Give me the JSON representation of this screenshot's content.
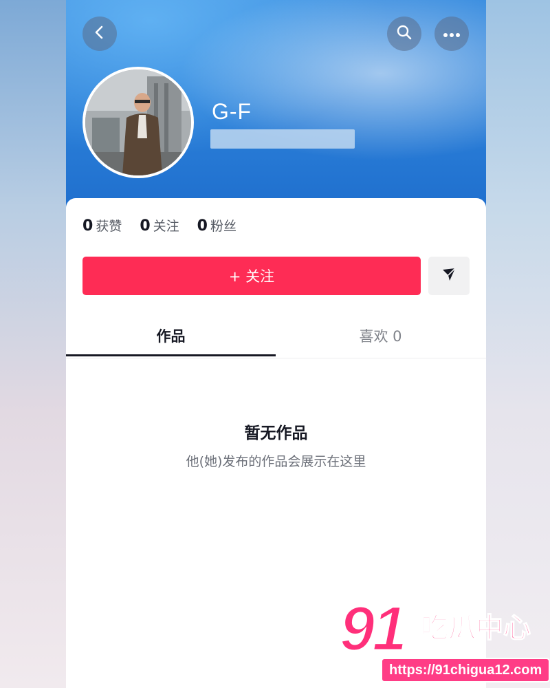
{
  "header": {
    "username": "G-F"
  },
  "stats": [
    {
      "value": "0",
      "label": "获赞"
    },
    {
      "value": "0",
      "label": "关注"
    },
    {
      "value": "0",
      "label": "粉丝"
    }
  ],
  "actions": {
    "follow_label": "+ 关注"
  },
  "tabs": {
    "works_label": "作品",
    "likes_label": "喜欢 0"
  },
  "empty_state": {
    "title": "暂无作品",
    "description": "他(她)发布的作品会展示在这里"
  },
  "watermark": {
    "logo_number": "91",
    "logo_text": "吃瓜中心",
    "url": "https://91chigua12.com"
  },
  "icons": [
    "back-icon",
    "search-icon",
    "more-icon",
    "send-icon"
  ],
  "colors": {
    "accent": "#fe2c55",
    "header_blue": "#2b7fd8",
    "watermark_pink": "#ff2f7a"
  }
}
